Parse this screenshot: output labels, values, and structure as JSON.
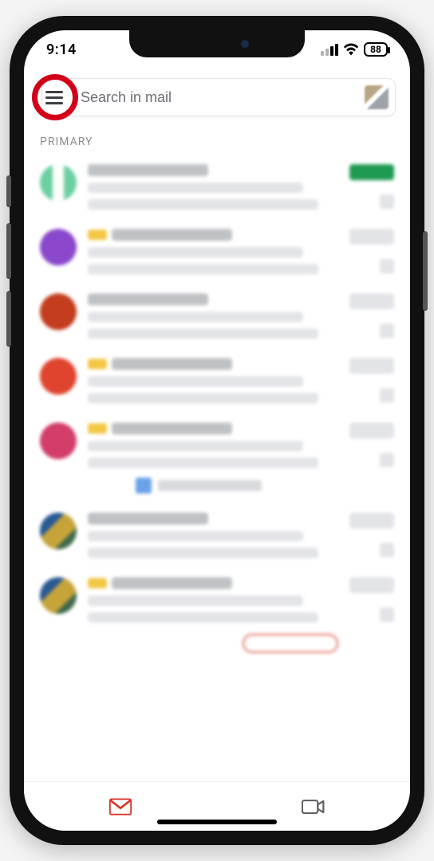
{
  "status": {
    "time": "9:14",
    "battery": "88"
  },
  "search": {
    "placeholder": "Search in mail"
  },
  "section_label": "PRIMARY",
  "tabs": {
    "mail": "Mail",
    "meet": "Meet"
  },
  "highlight": {
    "target": "menu-icon"
  },
  "emails": [
    {
      "avatar_class": "c0",
      "badge_color": "#1f9a52"
    },
    {
      "avatar_class": "c1",
      "has_yellow_chip": true
    },
    {
      "avatar_class": "c2"
    },
    {
      "avatar_class": "c3",
      "has_yellow_chip": true
    },
    {
      "avatar_class": "c4",
      "has_yellow_chip": true,
      "has_attachment": true
    },
    {
      "avatar_class": "c5"
    },
    {
      "avatar_class": "c6",
      "has_yellow_chip": true,
      "has_red_button": true
    }
  ]
}
